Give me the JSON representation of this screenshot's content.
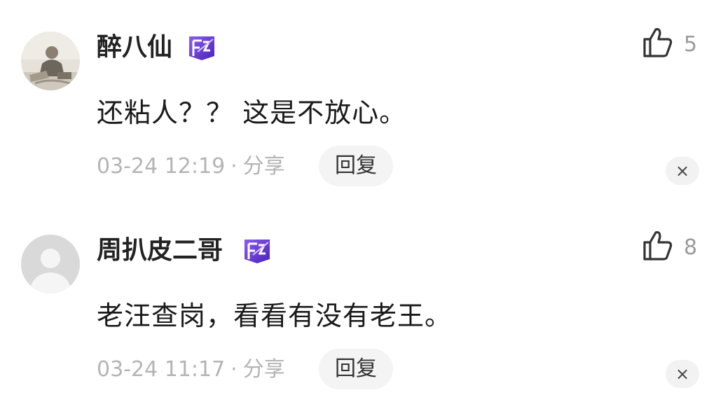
{
  "comments": [
    {
      "username": "醉八仙",
      "avatar": "photo-avatar",
      "badge_icon": "level-badge-icon",
      "like_icon": "thumbs-up-icon",
      "likes": "5",
      "content": "还粘人？？ 这是不放心。",
      "timestamp": "03-24 12:19",
      "separator": "·",
      "share_label": "分享",
      "reply_label": "回复",
      "close_label": "×"
    },
    {
      "username": "周扒皮二哥",
      "avatar": "default-user-avatar",
      "badge_icon": "level-badge-icon",
      "like_icon": "thumbs-up-icon",
      "likes": "8",
      "content": "老汪查岗，看看有没有老王。",
      "timestamp": "03-24 11:17",
      "separator": "·",
      "share_label": "分享",
      "reply_label": "回复",
      "close_label": "×"
    }
  ],
  "colors": {
    "badge_purple": "#6b3fd6",
    "meta_gray": "#b4b4b4",
    "reply_bg": "#f4f4f4"
  }
}
